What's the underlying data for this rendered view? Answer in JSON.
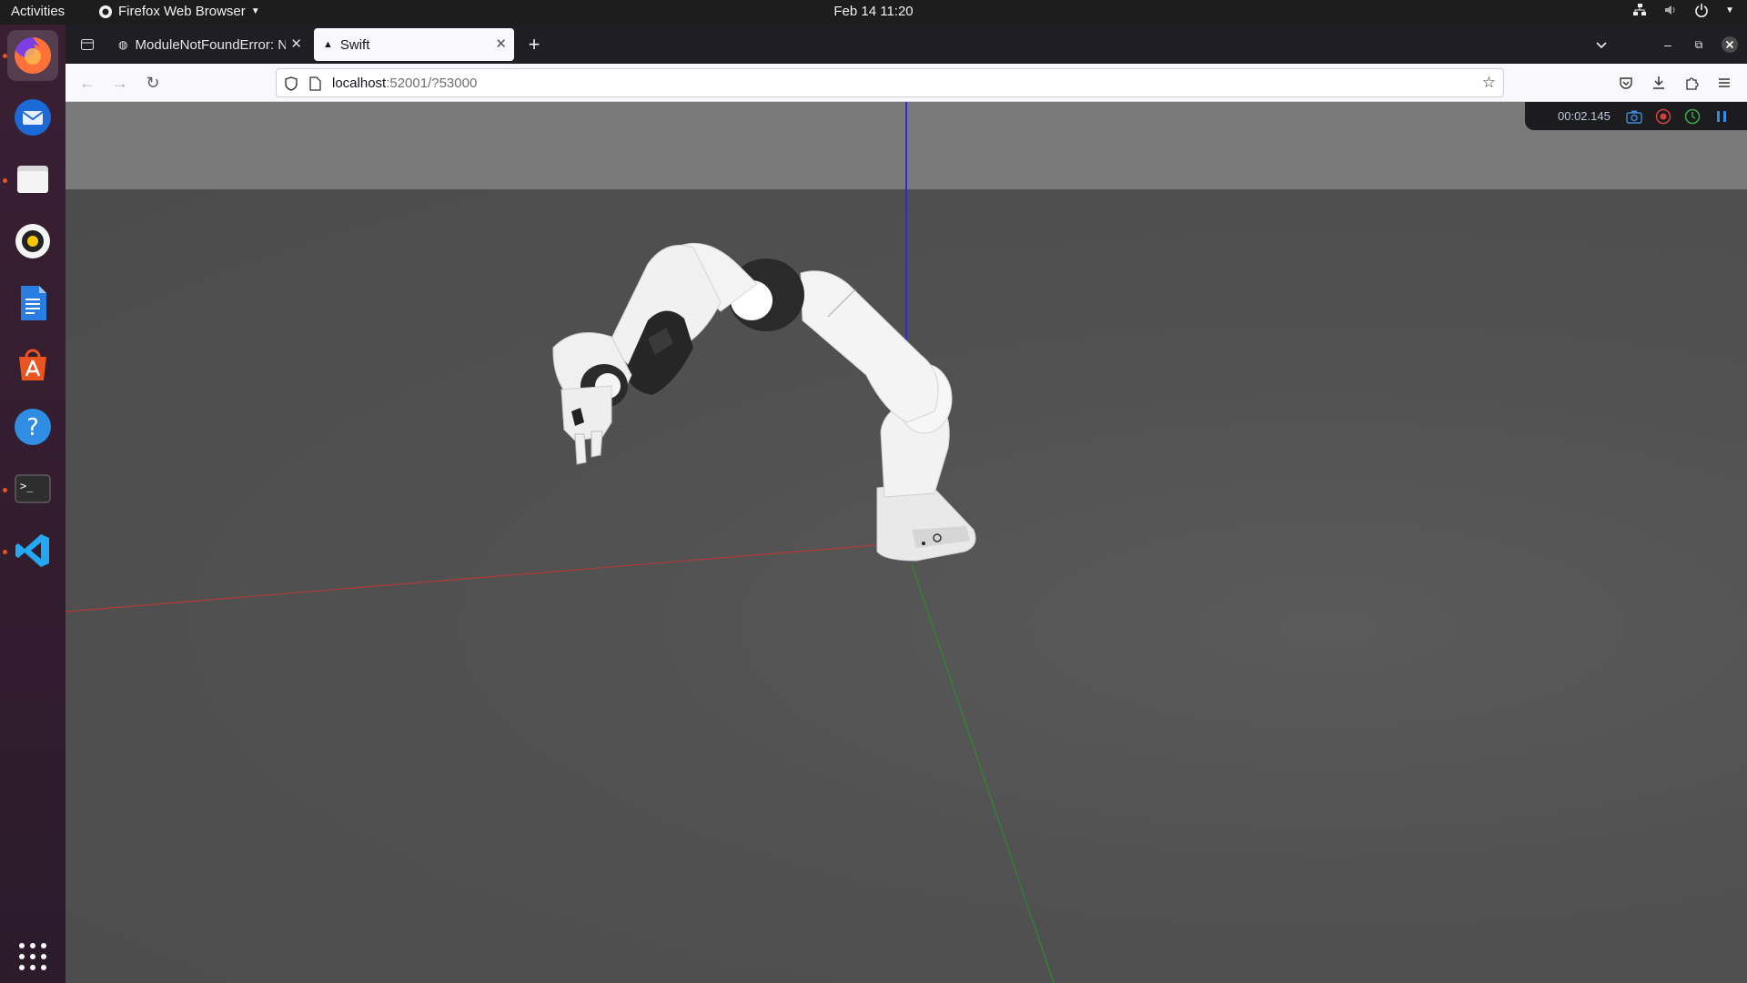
{
  "topbar": {
    "activities": "Activities",
    "app_name": "Firefox Web Browser",
    "clock": "Feb 14  11:20"
  },
  "dock": {
    "items": [
      "firefox-icon",
      "thunderbird-icon",
      "files-icon",
      "rhythmbox-icon",
      "writer-icon",
      "app-center-icon",
      "help-icon",
      "terminal-icon",
      "vscode-icon"
    ],
    "show_apps": "show-applications-icon"
  },
  "browser": {
    "tabs": [
      {
        "title": "ModuleNotFoundError: N",
        "selected": false
      },
      {
        "title": "Swift",
        "selected": true
      }
    ],
    "url_host": "localhost",
    "url_rest": ":52001/?53000"
  },
  "viewer": {
    "timer": "00:02.145",
    "colors": {
      "x_axis": "#b03a3a",
      "y_axis": "#2d8a2d",
      "z_axis": "#2a2adf"
    }
  }
}
